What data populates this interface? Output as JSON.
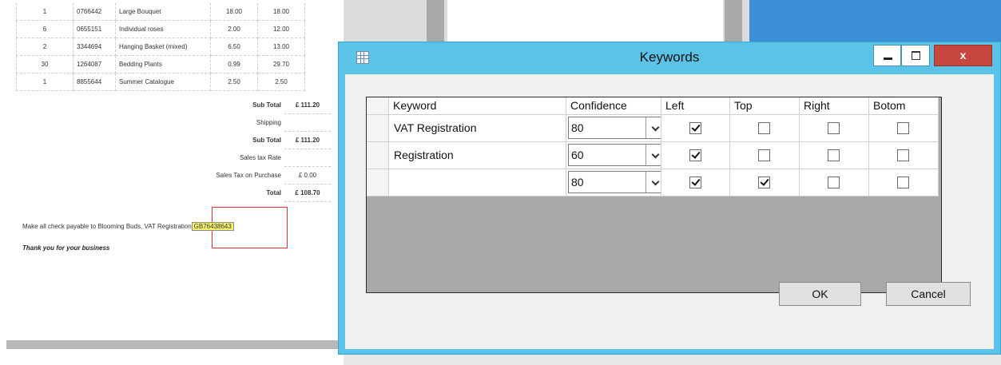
{
  "invoice": {
    "items": [
      {
        "qty": "1",
        "code": "0766442",
        "description": "Large Bouquet",
        "price": "18.00",
        "total": "18.00"
      },
      {
        "qty": "6",
        "code": "0655151",
        "description": "Individual roses",
        "price": "2.00",
        "total": "12.00"
      },
      {
        "qty": "2",
        "code": "3344694",
        "description": "Hanging Basket (mixed)",
        "price": "6.50",
        "total": "13.00"
      },
      {
        "qty": "30",
        "code": "1264087",
        "description": "Bedding Plants",
        "price": "0.99",
        "total": "29.70"
      },
      {
        "qty": "1",
        "code": "8855644",
        "description": "Summer Catalogue",
        "price": "2.50",
        "total": "2.50"
      }
    ],
    "summary": [
      {
        "label": "Sub Total",
        "value": "£ 111.20",
        "bold": true
      },
      {
        "label": "Shipping",
        "value": "",
        "bold": false
      },
      {
        "label": "Sub Total",
        "value": "£ 111.20",
        "bold": true
      },
      {
        "label": "Sales tax Rate",
        "value": "",
        "bold": false
      },
      {
        "label": "Sales Tax on Purchase",
        "value": "£ 0.00",
        "bold": false
      },
      {
        "label": "Total",
        "value": "£ 108.70",
        "bold": true
      }
    ],
    "payment_note": "Make all check payable to Blooming Buds, VAT Registration",
    "vat_number": "GB76438643",
    "thanks": "Thank you for your business"
  },
  "dialog": {
    "title": "Keywords",
    "close_glyph": "x",
    "columns": [
      "Keyword",
      "Confidence",
      "Left",
      "Top",
      "Right",
      "Botom"
    ],
    "rows": [
      {
        "keyword": "VAT Registration",
        "confidence": "80",
        "left": true,
        "top": false,
        "right": false,
        "bottom": false
      },
      {
        "keyword": "Registration",
        "confidence": "60",
        "left": true,
        "top": false,
        "right": false,
        "bottom": false
      },
      {
        "keyword": "",
        "confidence": "80",
        "left": true,
        "top": true,
        "right": false,
        "bottom": false
      }
    ],
    "ok_label": "OK",
    "cancel_label": "Cancel"
  }
}
